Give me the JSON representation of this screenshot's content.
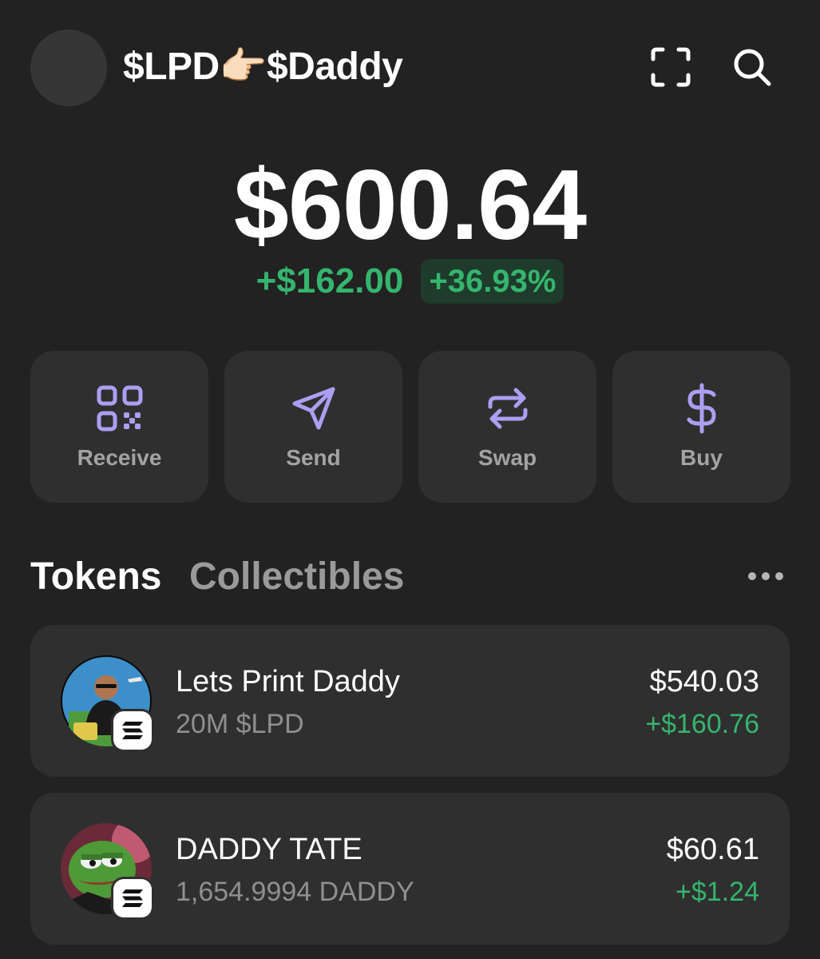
{
  "header": {
    "account_name": "$LPD👉🏻$Daddy",
    "scan_icon": "scan-frame-icon",
    "search_icon": "search-icon"
  },
  "portfolio": {
    "balance": "$600.64",
    "change_amount": "+$162.00",
    "change_percent": "+36.93%"
  },
  "actions": [
    {
      "label": "Receive",
      "icon": "qr-code-icon"
    },
    {
      "label": "Send",
      "icon": "paper-plane-icon"
    },
    {
      "label": "Swap",
      "icon": "swap-arrows-icon"
    },
    {
      "label": "Buy",
      "icon": "dollar-icon"
    }
  ],
  "tabs": {
    "tokens": "Tokens",
    "collectibles": "Collectibles",
    "active": "Tokens",
    "more_icon": "more-horizontal-icon"
  },
  "tokens": [
    {
      "name": "Lets Print Daddy",
      "amount": "20M $LPD",
      "value": "$540.03",
      "change": "+$160.76",
      "chain": "solana"
    },
    {
      "name": "DADDY TATE",
      "amount": "1,654.9994 DADDY",
      "value": "$60.61",
      "change": "+$1.24",
      "chain": "solana"
    }
  ],
  "colors": {
    "background": "#222222",
    "card": "#2f2f2f",
    "accent": "#ab9ff2",
    "positive": "#35b56e",
    "positive_bg": "#1e3b2b",
    "muted_text": "#a3a3a3"
  }
}
